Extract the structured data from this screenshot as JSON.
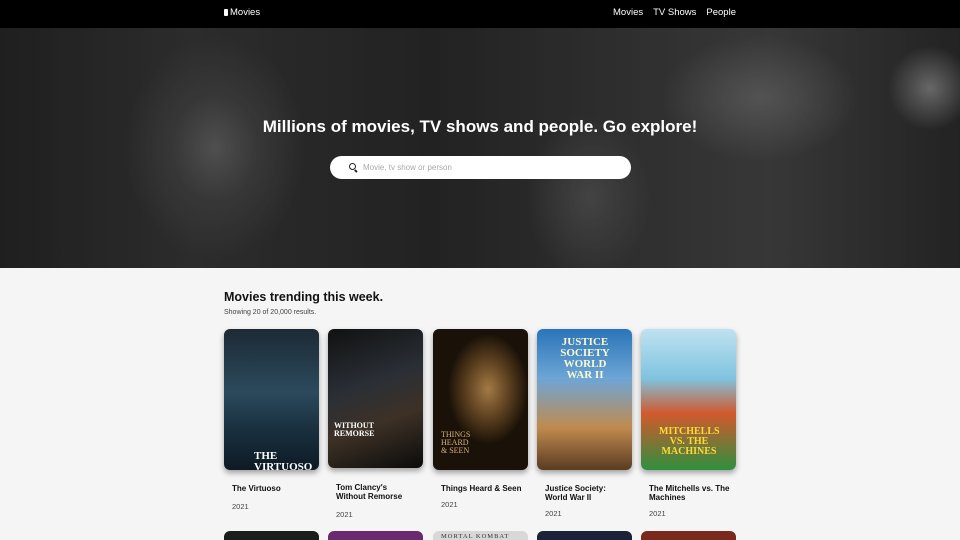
{
  "header": {
    "brand": "Movies",
    "nav": [
      "Movies",
      "TV Shows",
      "People"
    ]
  },
  "hero": {
    "title": "Millions of movies, TV shows and people. Go explore!",
    "search_placeholder": "Movie, tv show or person"
  },
  "trending": {
    "title": "Movies trending this week.",
    "subtitle": "Showing 20 of 20,000 results.",
    "items": [
      {
        "title": "The Virtuoso",
        "year": "2021",
        "poster_text": "THE VIRTUOSO"
      },
      {
        "title": "Tom Clancy's Without Remorse",
        "year": "2021",
        "poster_text": "WITHOUT REMORSE"
      },
      {
        "title": "Things Heard & Seen",
        "year": "2021",
        "poster_text": "THINGS HEARD & SEEN"
      },
      {
        "title": "Justice Society: World War II",
        "year": "2021",
        "poster_text": "JUSTICE SOCIETY WORLD WAR II"
      },
      {
        "title": "The Mitchells vs. The Machines",
        "year": "2021",
        "poster_text": "MITCHELLS vs. THE MACHINES"
      }
    ],
    "next_row_peek": [
      "",
      "",
      "MORTAL KOMBAT",
      "",
      ""
    ]
  },
  "colors": {
    "nav_bg": "#000000",
    "page_bg": "#f5f5f5",
    "text": "#111111"
  }
}
